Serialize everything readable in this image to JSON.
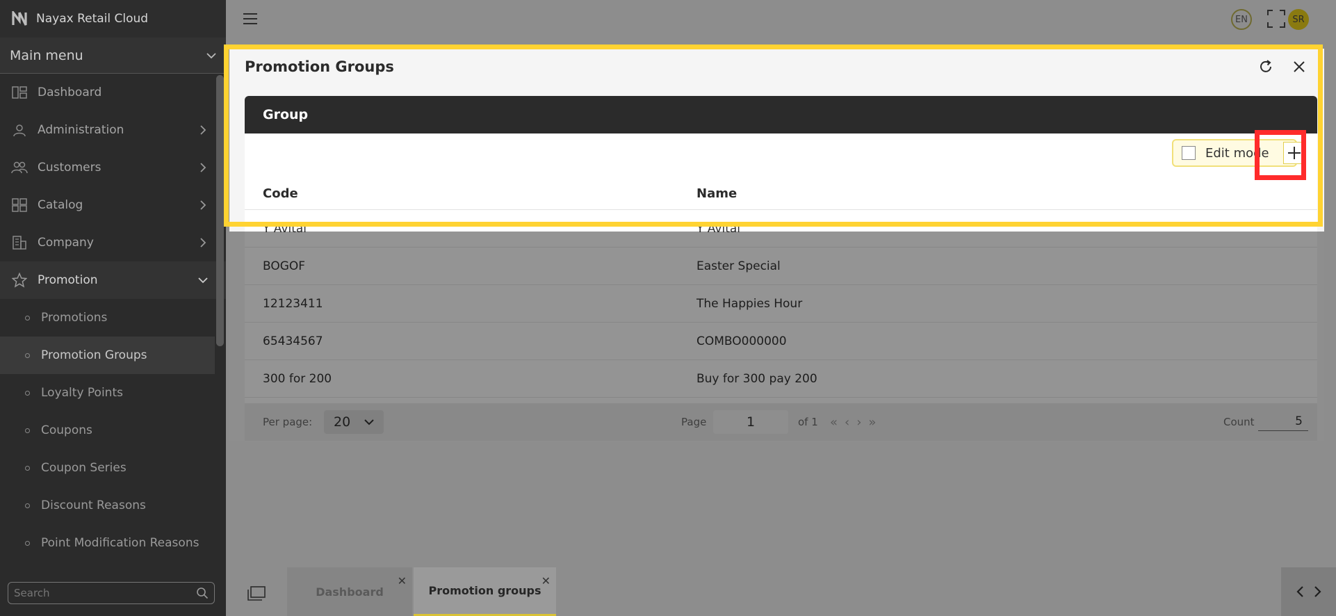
{
  "app": {
    "title": "Nayax Retail Cloud"
  },
  "sidebar": {
    "main_menu_label": "Main menu",
    "items": [
      {
        "label": "Dashboard",
        "icon": "dashboard-icon"
      },
      {
        "label": "Administration",
        "icon": "admin-icon"
      },
      {
        "label": "Customers",
        "icon": "customers-icon"
      },
      {
        "label": "Catalog",
        "icon": "catalog-icon"
      },
      {
        "label": "Company",
        "icon": "company-icon"
      },
      {
        "label": "Promotion",
        "icon": "star-icon"
      }
    ],
    "sub_items": [
      "Promotions",
      "Promotion Groups",
      "Loyalty Points",
      "Coupons",
      "Coupon Series",
      "Discount Reasons",
      "Point Modification Reasons"
    ],
    "search_placeholder": "Search"
  },
  "topbar": {
    "language": "EN",
    "avatar_initials": "SR"
  },
  "panel": {
    "title": "Promotion Groups",
    "card_header": "Group",
    "edit_mode_label": "Edit mode",
    "columns": [
      "Code",
      "Name"
    ],
    "rows": [
      {
        "code": "Y Avital",
        "name": "Y Avital"
      },
      {
        "code": "BOGOF",
        "name": "Easter Special"
      },
      {
        "code": "12123411",
        "name": "The Happies Hour"
      },
      {
        "code": "65434567",
        "name": "COMBO000000"
      },
      {
        "code": "300 for 200",
        "name": "Buy for 300 pay 200"
      }
    ],
    "footer": {
      "per_page_label": "Per page:",
      "per_page_value": "20",
      "page_label": "Page",
      "page_value": "1",
      "of_pages": "of 1",
      "count_label": "Count",
      "count_value": "5"
    }
  },
  "tabs": [
    {
      "label": "Dashboard"
    },
    {
      "label": "Promotion groups"
    }
  ],
  "colors": {
    "highlight_yellow": "#ffd332",
    "highlight_red": "#ff2b2b",
    "sidebar_bg": "#2b2b2b"
  }
}
